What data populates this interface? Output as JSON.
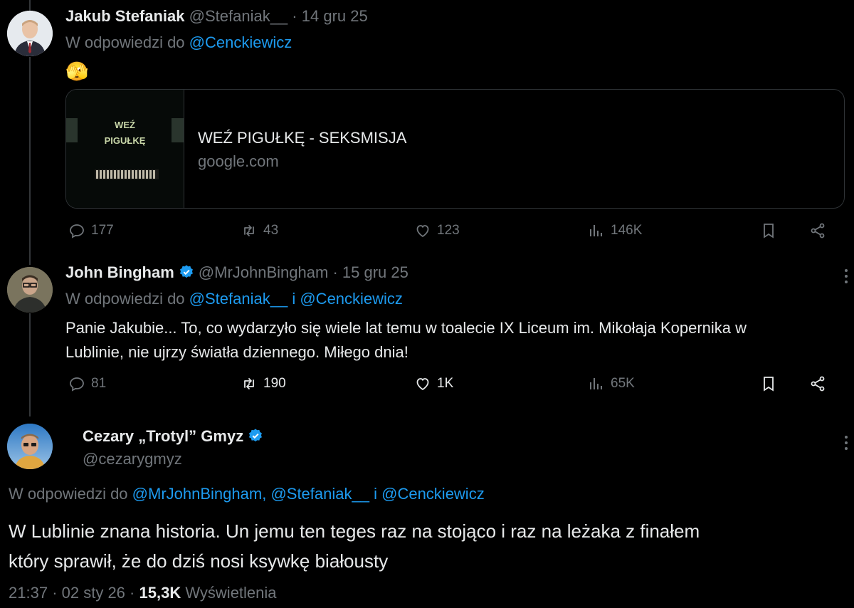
{
  "tweet1": {
    "name": "Jakub Stefaniak",
    "handle": "@Stefaniak__",
    "sep": "·",
    "date": "14 gru 25",
    "reply_prefix": "W odpowiedzi do",
    "reply_to": "@Cenckiewicz",
    "emoji": "🫣",
    "card": {
      "thumb_word1": "WEŹ",
      "thumb_word2": "PIGUŁKĘ",
      "title": "WEŹ PIGUŁKĘ - SEKSMISJA",
      "domain": "google.com"
    },
    "actions": {
      "replies": "177",
      "reposts": "43",
      "likes": "123",
      "views": "146K"
    }
  },
  "tweet2": {
    "name": "John Bingham",
    "handle": "@MrJohnBingham",
    "sep": "·",
    "date": "15 gru 25",
    "reply_prefix": "W odpowiedzi do",
    "reply_to_1": "@Stefaniak__",
    "and": "i",
    "reply_to_2": "@Cenckiewicz",
    "text_line1": "Panie Jakubie... To, co wydarzyło się wiele lat temu w toalecie IX Liceum im. Mikołaja Kopernika w",
    "text_line2": "Lublinie, nie ujrzy światła dziennego. Miłego dnia!",
    "actions": {
      "replies": "81",
      "reposts": "190",
      "likes": "1K",
      "views": "65K"
    }
  },
  "tweet3": {
    "name": "Cezary „Trotyl” Gmyz",
    "handle": "@cezarygmyz",
    "reply_prefix": "W odpowiedzi do",
    "reply_to_1": "@MrJohnBingham,",
    "reply_to_2": "@Stefaniak__",
    "and": "i",
    "reply_to_3": "@Cenckiewicz",
    "text_line1": "W Lublinie znana historia. Un jemu ten teges raz na stojąco i raz na leżaka z finałem",
    "text_line2": "który sprawił, że do dziś nosi ksywkę białousty",
    "time": "21:37",
    "sep": "·",
    "date": "02 sty 26",
    "views": "15,3K",
    "views_label": "Wyświetlenia"
  },
  "colors": {
    "background": "#000000",
    "text": "#e7e9ea",
    "muted": "#71767b",
    "link": "#1d9bf0",
    "border": "#2f3336"
  }
}
